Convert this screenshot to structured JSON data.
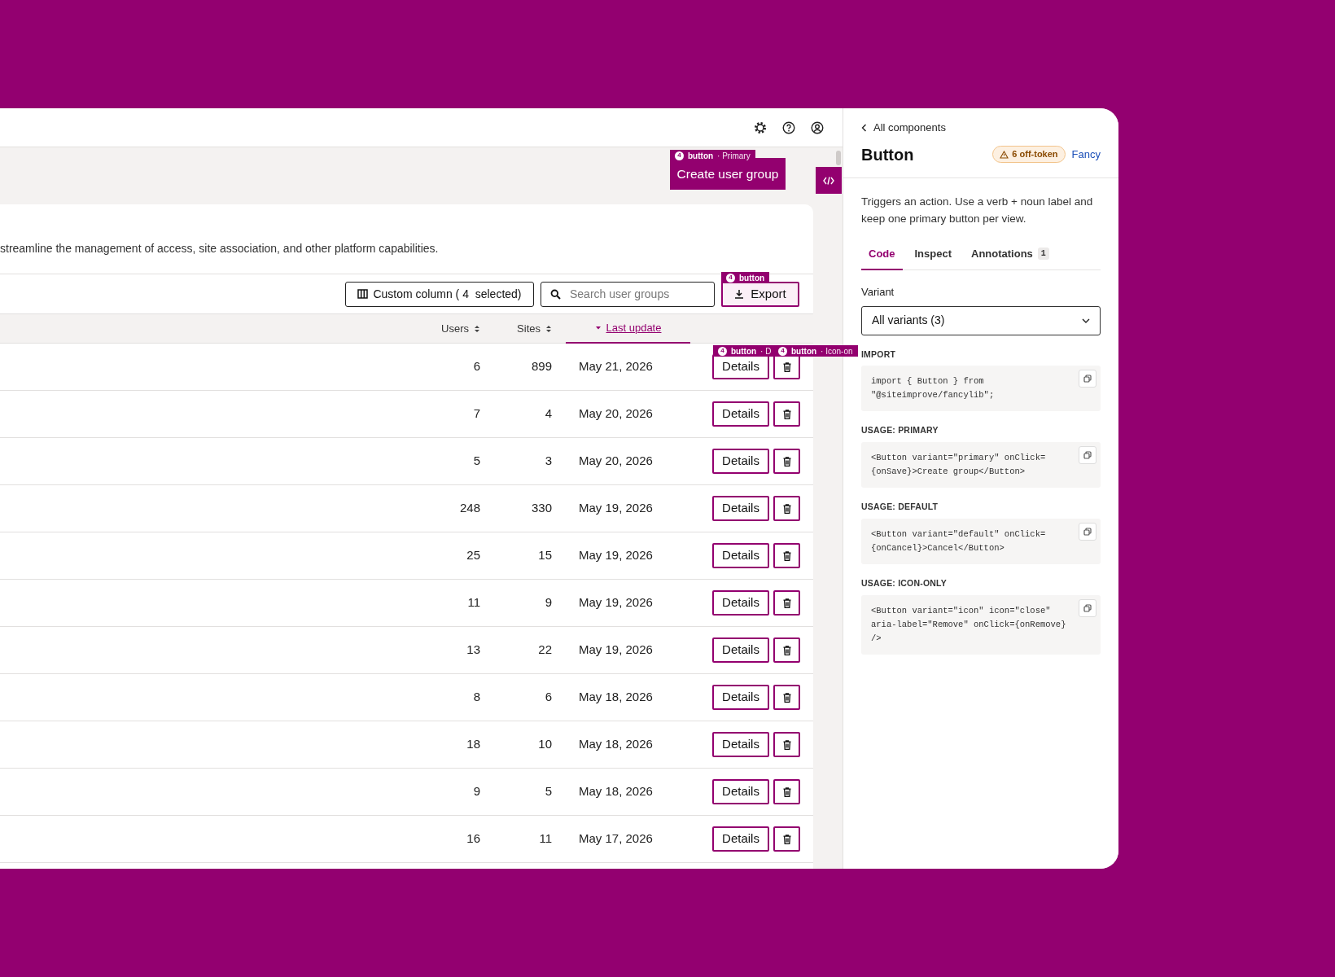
{
  "page_header": {
    "primary_button": "Create user group",
    "tag": {
      "count": "4",
      "label": "button",
      "variant": "· Primary"
    }
  },
  "description": "streamline the management of access, site association, and other platform capabilities.",
  "toolbar": {
    "custom_column": "Custom column ( 4  selected)",
    "search": {
      "placeholder": "Search user groups"
    },
    "export": "Export",
    "export_tag": {
      "count": "4",
      "label": "button"
    }
  },
  "table": {
    "columns": [
      {
        "label": "Users",
        "sorted": false
      },
      {
        "label": "Sites",
        "sorted": false
      },
      {
        "label": "Last update",
        "sorted": true
      }
    ],
    "rows": [
      {
        "users": "6",
        "sites": "899",
        "last_update": "May 21, 2026",
        "action": "Details"
      },
      {
        "users": "7",
        "sites": "4",
        "last_update": "May 20, 2026",
        "action": "Details"
      },
      {
        "users": "5",
        "sites": "3",
        "last_update": "May 20, 2026",
        "action": "Details"
      },
      {
        "users": "248",
        "sites": "330",
        "last_update": "May 19, 2026",
        "action": "Details"
      },
      {
        "users": "25",
        "sites": "15",
        "last_update": "May 19, 2026",
        "action": "Details"
      },
      {
        "users": "11",
        "sites": "9",
        "last_update": "May 19, 2026",
        "action": "Details"
      },
      {
        "users": "13",
        "sites": "22",
        "last_update": "May 19, 2026",
        "action": "Details"
      },
      {
        "users": "8",
        "sites": "6",
        "last_update": "May 18, 2026",
        "action": "Details"
      },
      {
        "users": "18",
        "sites": "10",
        "last_update": "May 18, 2026",
        "action": "Details"
      },
      {
        "users": "9",
        "sites": "5",
        "last_update": "May 18, 2026",
        "action": "Details"
      },
      {
        "users": "16",
        "sites": "11",
        "last_update": "May 17, 2026",
        "action": "Details"
      }
    ],
    "row_tags": [
      {
        "count": "4",
        "label": "button",
        "variant": "· D"
      },
      {
        "count": "4",
        "label": "button",
        "variant": "· Icon-on"
      }
    ]
  },
  "panel": {
    "back_link": "All components",
    "title": "Button",
    "badge": "6 off-token",
    "link": "Fancy",
    "description": "Triggers an action. Use a verb + noun label and keep one primary button per view.",
    "tabs": [
      {
        "label": "Code",
        "selected": true
      },
      {
        "label": "Inspect",
        "selected": false
      },
      {
        "label": "Annotations",
        "selected": false,
        "count": "1"
      }
    ],
    "variant": {
      "label": "Variant",
      "value": "All variants (3)"
    },
    "sections": [
      {
        "label": "IMPORT",
        "lines": [
          "import { Button } from",
          "\"@siteimprove/fancylib\";"
        ]
      },
      {
        "label": "USAGE: PRIMARY",
        "lines": [
          "<Button variant=\"primary\" onClick=",
          "{onSave}>Create group</Button>"
        ]
      },
      {
        "label": "USAGE: DEFAULT",
        "lines": [
          "<Button variant=\"default\" onClick=",
          "{onCancel}>Cancel</Button>"
        ]
      },
      {
        "label": "USAGE: ICON-ONLY",
        "lines": [
          "<Button variant=\"icon\" icon=\"close\"",
          "aria-label=\"Remove\" onClick={onRemove}",
          "/>"
        ]
      }
    ]
  }
}
